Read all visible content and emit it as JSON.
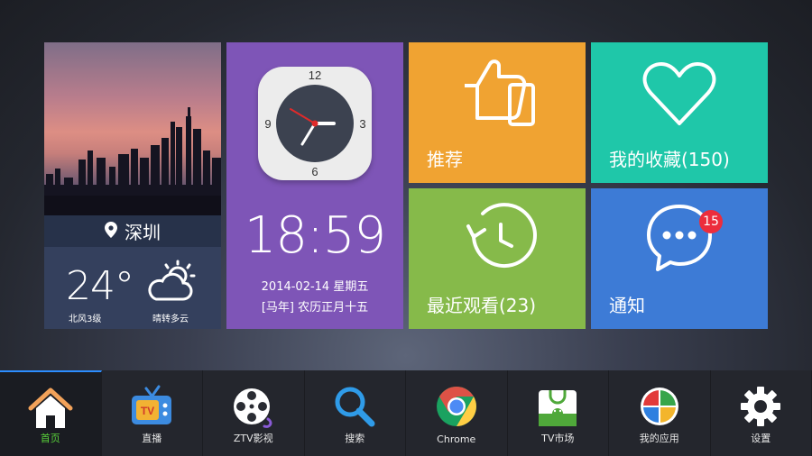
{
  "weather": {
    "city": "深圳",
    "temperature": "24°",
    "wind": "北风3级",
    "condition": "晴转多云",
    "icons": [
      "location-pin-icon",
      "partly-cloudy-icon"
    ]
  },
  "clock": {
    "dial_numbers": [
      "12",
      "3",
      "6",
      "9"
    ],
    "time": "18:59",
    "date": "2014-02-14 星期五",
    "lunar": "[马年] 农历正月十五"
  },
  "tiles": {
    "recommend": {
      "label": "推荐",
      "icon": "thumbs-up-icon",
      "color": "#f0a332"
    },
    "favorites": {
      "label": "我的收藏(150)",
      "icon": "heart-icon",
      "color": "#1fc7a9"
    },
    "history": {
      "label": "最近观看(23)",
      "icon": "history-clock-icon",
      "color": "#86ba4a"
    },
    "notifications": {
      "label": "通知",
      "icon": "chat-bubble-icon",
      "badge": "15",
      "color": "#3d7bd6"
    }
  },
  "dock": {
    "items": [
      {
        "label": "首页",
        "icon": "home-icon"
      },
      {
        "label": "直播",
        "icon": "tv-icon"
      },
      {
        "label": "ZTV影视",
        "icon": "film-reel-icon"
      },
      {
        "label": "搜索",
        "icon": "search-icon"
      },
      {
        "label": "Chrome",
        "icon": "chrome-icon"
      },
      {
        "label": "TV市场",
        "icon": "tv-market-icon"
      },
      {
        "label": "我的应用",
        "icon": "my-apps-icon"
      },
      {
        "label": "设置",
        "icon": "gear-icon"
      }
    ],
    "active_index": 0,
    "accent_color": "#2c8dff",
    "active_label_color": "#59d23a"
  }
}
